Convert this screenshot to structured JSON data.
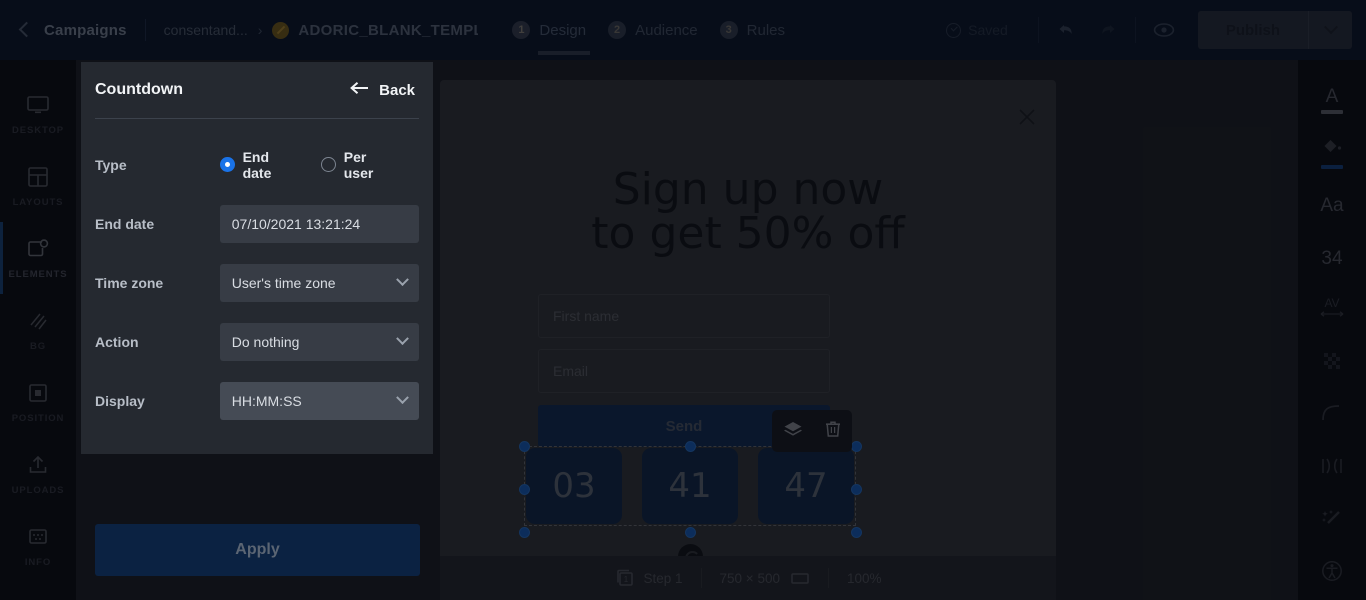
{
  "topbar": {
    "back_label": "",
    "campaigns": "Campaigns",
    "site": "consentand...",
    "crumb_arrow": "›",
    "template": "ADORIC_BLANK_TEMPL",
    "steps": [
      {
        "num": "1",
        "label": "Design",
        "active": true
      },
      {
        "num": "2",
        "label": "Audience",
        "active": false
      },
      {
        "num": "3",
        "label": "Rules",
        "active": false
      }
    ],
    "saved_label": "Saved",
    "undo_icon": "undo-icon",
    "redo_icon": "redo-icon",
    "preview_icon": "eye-icon",
    "publish_label": "Publish",
    "publish_caret_icon": "chevron-down-icon"
  },
  "left_rail": [
    {
      "label": "DESKTOP",
      "icon": "monitor-icon",
      "active": false
    },
    {
      "label": "LAYOUTS",
      "icon": "layouts-icon",
      "active": false
    },
    {
      "label": "ELEMENTS",
      "icon": "elements-icon",
      "active": true
    },
    {
      "label": "BG",
      "icon": "background-icon",
      "active": false
    },
    {
      "label": "POSITION",
      "icon": "position-icon",
      "active": false
    },
    {
      "label": "UPLOADS",
      "icon": "upload-icon",
      "active": false
    },
    {
      "label": "INFO",
      "icon": "info-icon",
      "active": false
    }
  ],
  "right_rail": [
    {
      "name": "text-color",
      "glyph": "A",
      "swatch": "#6f6f74"
    },
    {
      "name": "fill-color",
      "glyph": "",
      "swatch": "#16488c",
      "icon": "paint-bucket-icon"
    },
    {
      "name": "font-family",
      "glyph": "Aa",
      "swatch": ""
    },
    {
      "name": "font-size",
      "glyph": "34",
      "swatch": ""
    },
    {
      "name": "letter-spacing",
      "glyph": "AV",
      "swatch": ""
    },
    {
      "name": "opacity",
      "glyph": "",
      "swatch": "",
      "icon": "checkerboard-icon"
    },
    {
      "name": "corner-radius",
      "glyph": "",
      "swatch": "",
      "icon": "corner-radius-icon"
    },
    {
      "name": "padding",
      "glyph": "",
      "swatch": "",
      "icon": "padding-icon"
    },
    {
      "name": "effects",
      "glyph": "",
      "swatch": "",
      "icon": "magic-wand-icon"
    },
    {
      "name": "accessibility",
      "glyph": "",
      "swatch": "",
      "icon": "accessibility-icon"
    }
  ],
  "panel": {
    "title": "Countdown",
    "back_label": "Back",
    "back_icon": "arrow-left-icon",
    "rows": {
      "type_label": "Type",
      "type_options": [
        {
          "label": "End date",
          "checked": true
        },
        {
          "label": "Per user",
          "checked": false
        }
      ],
      "end_date_label": "End date",
      "end_date_value": "07/10/2021 13:21:24",
      "time_zone_label": "Time zone",
      "time_zone_value": "User's time zone",
      "action_label": "Action",
      "action_value": "Do nothing",
      "display_label": "Display",
      "display_value": "HH:MM:SS"
    },
    "apply_label": "Apply"
  },
  "canvas": {
    "close_icon": "close-icon",
    "headline": "Sign up now\nto get 50% off",
    "first_name_placeholder": "First name",
    "email_placeholder": "Email",
    "send_label": "Send",
    "countdown": [
      "03",
      "41",
      "47"
    ],
    "float_toolbar": [
      {
        "name": "layers-icon"
      },
      {
        "name": "trash-icon"
      }
    ]
  },
  "statusbar": {
    "step_icon": "pages-icon",
    "step_label": "Step 1",
    "size_label": "750 × 500",
    "size_icon": "rectangle-icon",
    "zoom_label": "100%"
  },
  "colors": {
    "accent_blue": "#1a73e8",
    "topbar_bg": "#0d1729",
    "panel_bg": "#252930",
    "canvas_bg": "#212123",
    "popup_bg": "#3a3a3b",
    "countdown_box": "#132b4c",
    "send_button": "#14305b",
    "badge_gold": "#c79a2a"
  }
}
